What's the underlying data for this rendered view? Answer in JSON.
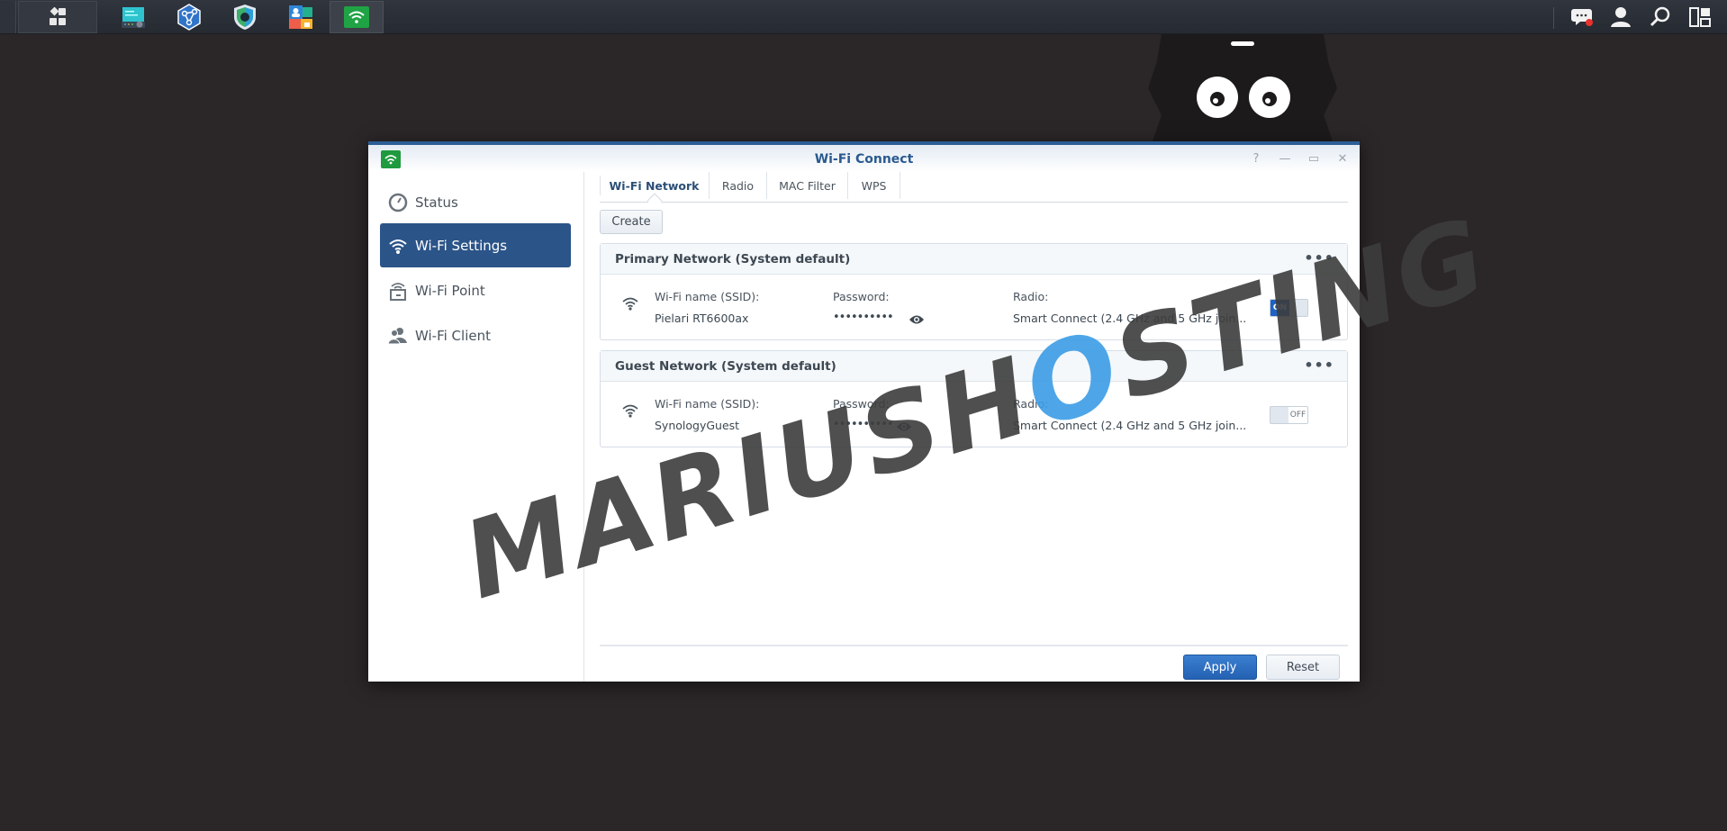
{
  "taskbar": {
    "main_menu_icon": "grid-menu-icon",
    "apps": [
      {
        "name": "storage-manager",
        "icon": "storage-icon",
        "active": false
      },
      {
        "name": "network-center",
        "icon": "network-icon",
        "active": false
      },
      {
        "name": "security-advisor",
        "icon": "shield-icon",
        "active": false
      },
      {
        "name": "control-panel",
        "icon": "control-panel-icon",
        "active": false
      },
      {
        "name": "wifi-connect",
        "icon": "wifi-icon",
        "active": true
      }
    ],
    "right_icons": [
      "notifications-icon",
      "user-icon",
      "search-icon",
      "widgets-icon"
    ],
    "notification_badge": true
  },
  "window": {
    "title": "Wi-Fi Connect",
    "controls": {
      "help": "?",
      "minimize": "—",
      "maximize": "▭",
      "close": "✕"
    }
  },
  "sidebar": {
    "items": [
      {
        "label": "Status",
        "icon": "gauge-icon",
        "active": false
      },
      {
        "label": "Wi-Fi Settings",
        "icon": "wifi-icon",
        "active": true
      },
      {
        "label": "Wi-Fi Point",
        "icon": "wifi-point-icon",
        "active": false
      },
      {
        "label": "Wi-Fi Client",
        "icon": "users-icon",
        "active": false
      }
    ]
  },
  "tabs": [
    {
      "label": "Wi-Fi Network",
      "active": true
    },
    {
      "label": "Radio",
      "active": false
    },
    {
      "label": "MAC Filter",
      "active": false
    },
    {
      "label": "WPS",
      "active": false
    }
  ],
  "toolbar": {
    "create_label": "Create"
  },
  "networks": [
    {
      "title": "Primary Network (System default)",
      "ssid_label": "Wi-Fi name (SSID):",
      "ssid": "Pielari RT6600ax",
      "password_label": "Password:",
      "password_masked": "••••••••••",
      "radio_label": "Radio:",
      "radio": "Smart Connect (2.4 GHz and 5 GHz join...",
      "enabled": true,
      "toggle_label": "ON"
    },
    {
      "title": "Guest Network (System default)",
      "ssid_label": "Wi-Fi name (SSID):",
      "ssid": "SynologyGuest",
      "password_label": "Password:",
      "password_masked": "••••••••••",
      "radio_label": "Radio:",
      "radio": "Smart Connect (2.4 GHz and 5 GHz join...",
      "enabled": false,
      "toggle_label": "OFF"
    }
  ],
  "footer": {
    "apply_label": "Apply",
    "reset_label": "Reset"
  },
  "watermark": {
    "pre": "MARIUSH",
    "o": "O",
    "post": "STING"
  },
  "colors": {
    "accent": "#2b5488",
    "window_border": "#2c5d96",
    "apply": "#2461b3",
    "toggle_on": "#1f63c2",
    "wifi_app": "#1f9a3e"
  }
}
